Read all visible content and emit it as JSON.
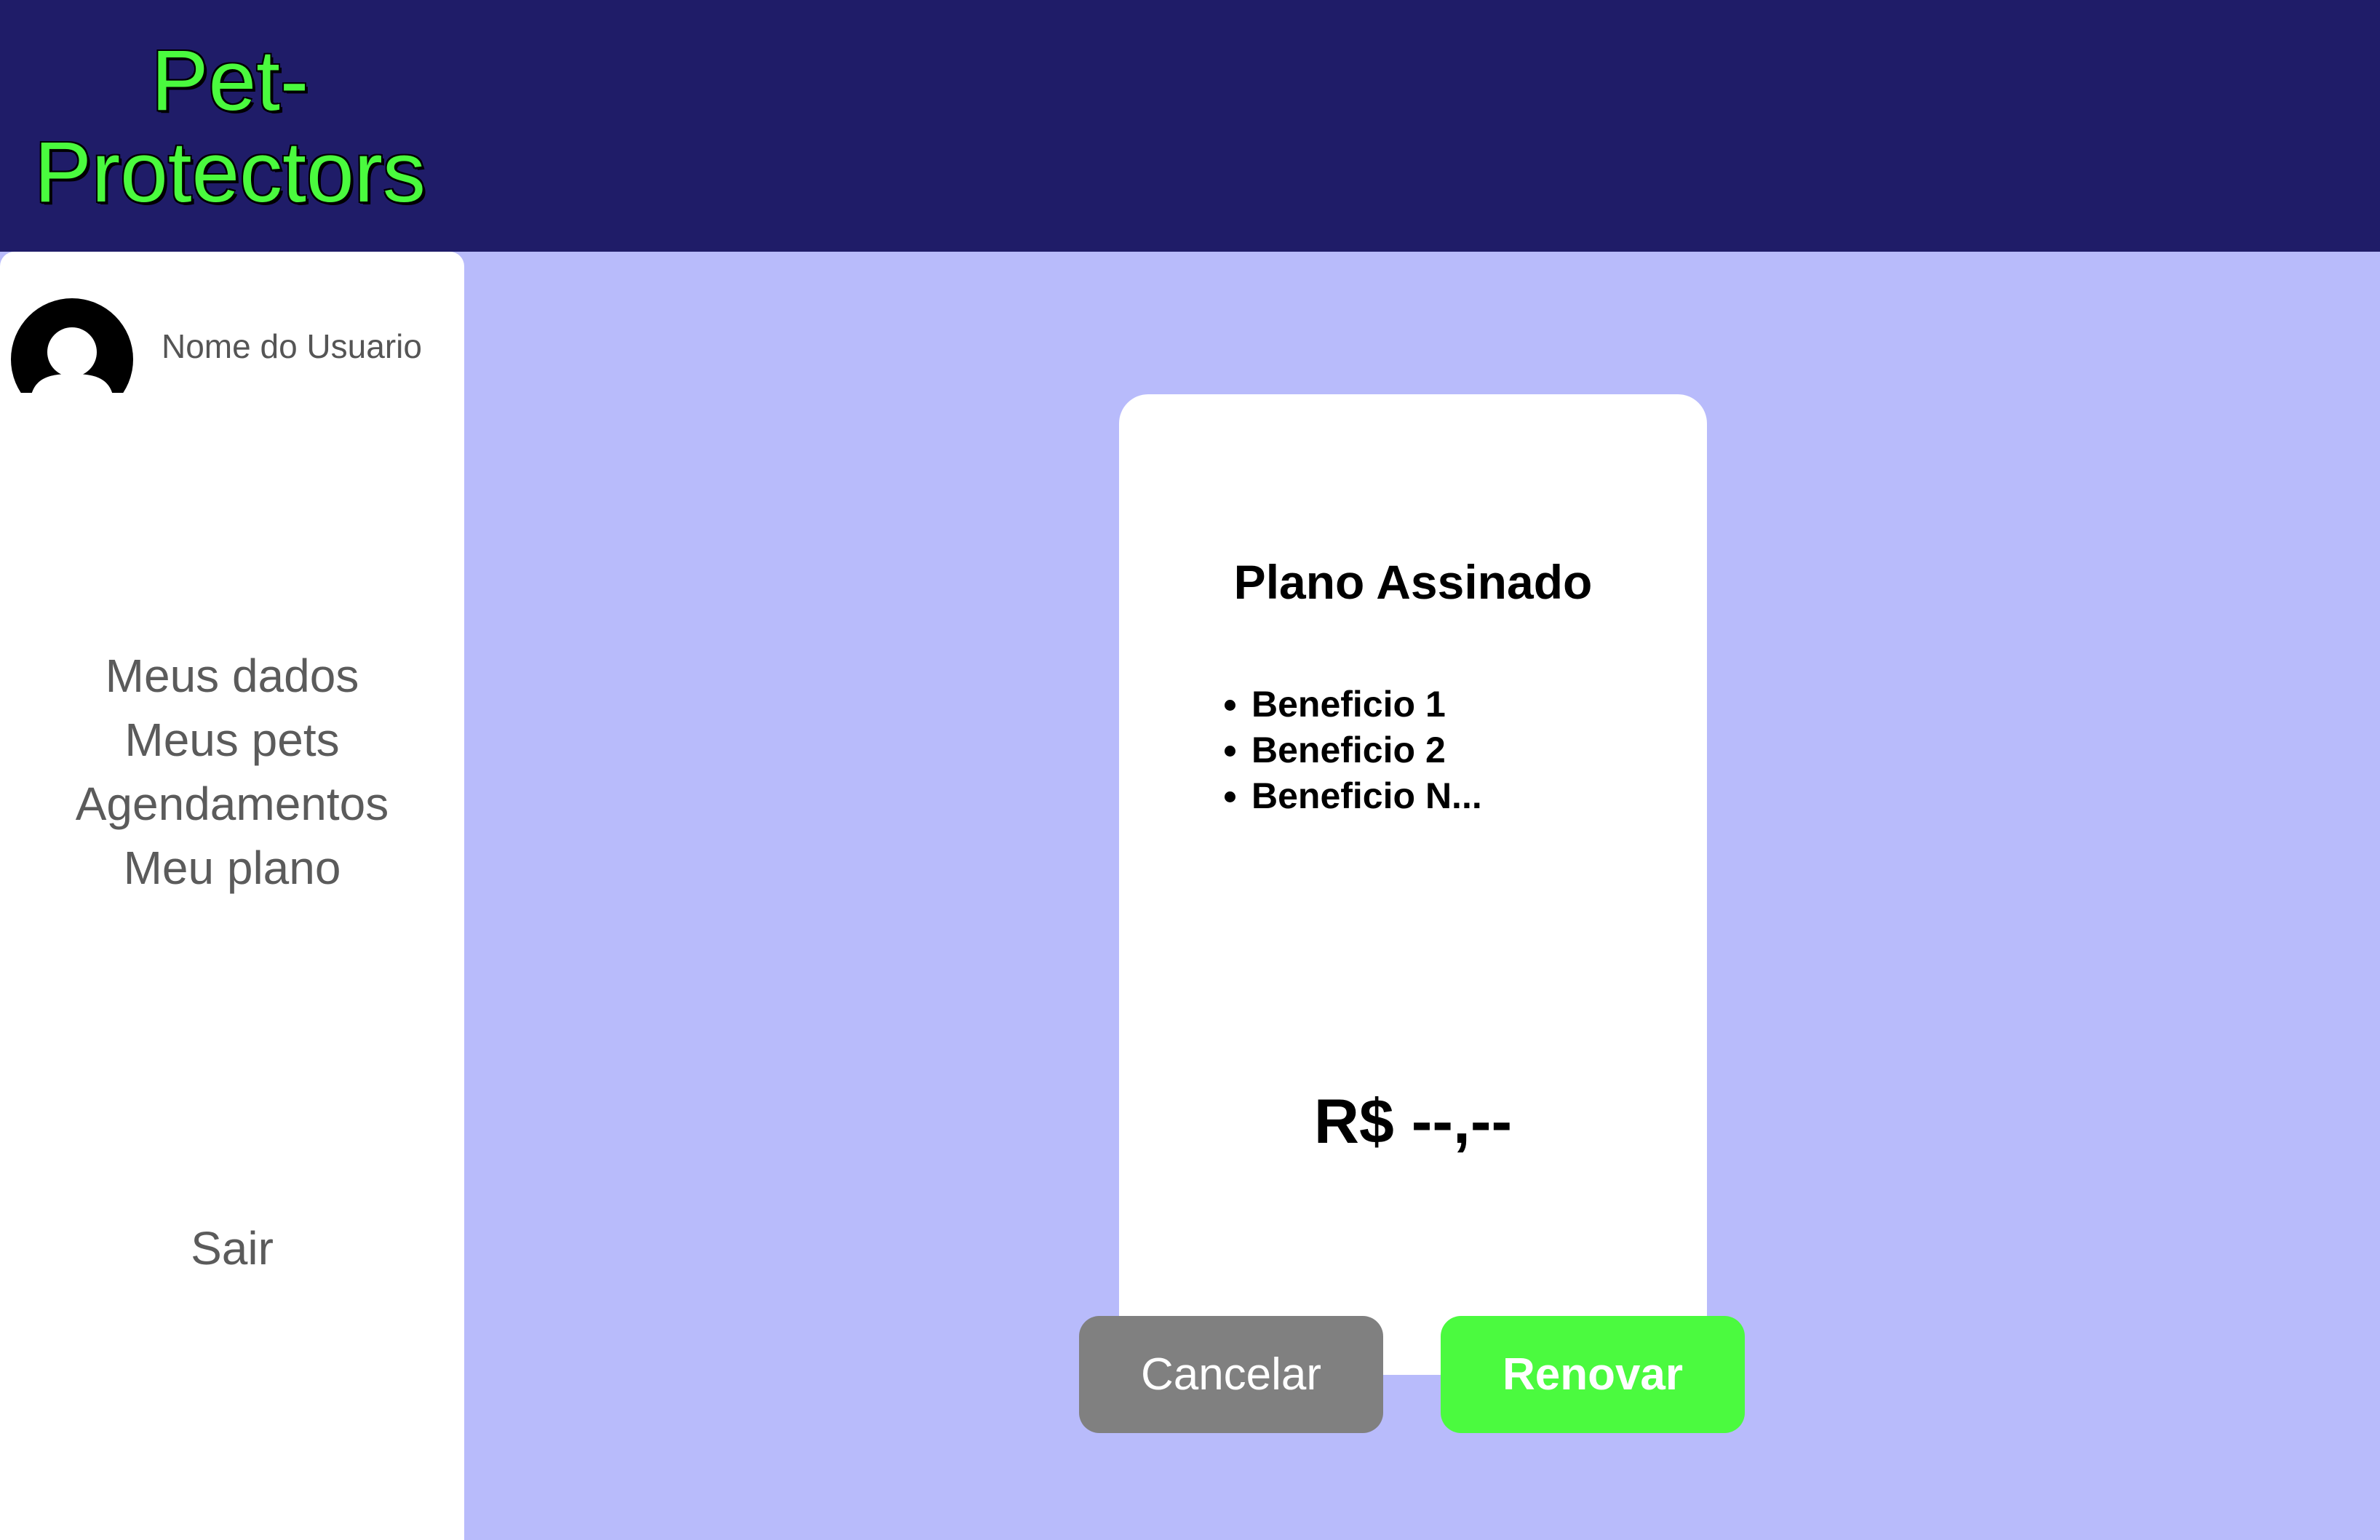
{
  "header": {
    "logo_line1": "Pet-",
    "logo_line2": "Protectors"
  },
  "sidebar": {
    "username": "Nome do Usuario",
    "avatar_icon": "user-avatar-icon",
    "nav_items": [
      {
        "label": "Meus dados"
      },
      {
        "label": "Meus pets"
      },
      {
        "label": "Agendamentos"
      },
      {
        "label": "Meu plano"
      }
    ],
    "logout_label": "Sair"
  },
  "plan_card": {
    "title": "Plano Assinado",
    "benefits": [
      "Beneficio 1",
      "Beneficio 2",
      "Beneficio N..."
    ],
    "price": "R$ --,--"
  },
  "actions": {
    "cancel_label": "Cancelar",
    "renew_label": "Renovar"
  },
  "colors": {
    "header_bg": "#1f1c68",
    "page_bg": "#b8bbfb",
    "logo": "#4afa3e",
    "cancel_bg": "#808080",
    "renew_bg": "#4bfa3f"
  }
}
